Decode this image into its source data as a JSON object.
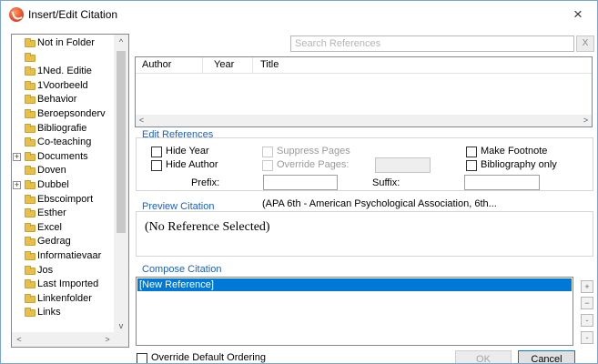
{
  "window": {
    "title": "Insert/Edit Citation",
    "close_glyph": "×"
  },
  "folders": [
    {
      "label": "Not in Folder",
      "expander": ""
    },
    {
      "label": "",
      "expander": ""
    },
    {
      "label": "1Ned. Editie",
      "expander": ""
    },
    {
      "label": "1Voorbeeld",
      "expander": ""
    },
    {
      "label": "Behavior",
      "expander": ""
    },
    {
      "label": "Beroepsonderv",
      "expander": ""
    },
    {
      "label": "Bibliografie",
      "expander": ""
    },
    {
      "label": "Co-teaching",
      "expander": ""
    },
    {
      "label": "Documents",
      "expander": "+"
    },
    {
      "label": "Doven",
      "expander": ""
    },
    {
      "label": "Dubbel",
      "expander": "+"
    },
    {
      "label": "Ebscoimport",
      "expander": ""
    },
    {
      "label": "Esther",
      "expander": ""
    },
    {
      "label": "Excel",
      "expander": ""
    },
    {
      "label": "Gedrag",
      "expander": ""
    },
    {
      "label": "Informatievaar",
      "expander": ""
    },
    {
      "label": "Jos",
      "expander": ""
    },
    {
      "label": "Last Imported",
      "expander": ""
    },
    {
      "label": "Linkenfolder",
      "expander": ""
    },
    {
      "label": "Links",
      "expander": ""
    }
  ],
  "tree_scroll": {
    "up": "^",
    "down": "v",
    "left": "<",
    "right": ">"
  },
  "search": {
    "placeholder": "Search References",
    "value": "",
    "clear_label": "X"
  },
  "reference_table": {
    "columns": [
      "Author",
      "Year",
      "Title"
    ],
    "rows": [],
    "scroll_left": "<",
    "scroll_right": ">"
  },
  "edit_references": {
    "title": "Edit References",
    "hide_year": "Hide Year",
    "hide_author": "Hide Author",
    "suppress_pages": "Suppress Pages",
    "override_pages": "Override Pages:",
    "make_footnote": "Make Footnote",
    "bibliography_only": "Bibliography only",
    "prefix_label": "Prefix:",
    "suffix_label": "Suffix:"
  },
  "preview": {
    "title": "Preview Citation",
    "style": "(APA 6th - American Psychological Association, 6th...",
    "text": "(No Reference Selected)"
  },
  "compose": {
    "title": "Compose Citation",
    "items": [
      "[New Reference]"
    ],
    "side_buttons": [
      "+",
      "−",
      "-",
      "-"
    ]
  },
  "footer": {
    "override_ordering": "Override Default Ordering",
    "ok": "OK",
    "cancel": "Cancel"
  },
  "colors": {
    "section_title": "#1a5fc8",
    "selection": "#0078d7",
    "folder": "#e6c04a",
    "app_icon": "#e8502a"
  }
}
